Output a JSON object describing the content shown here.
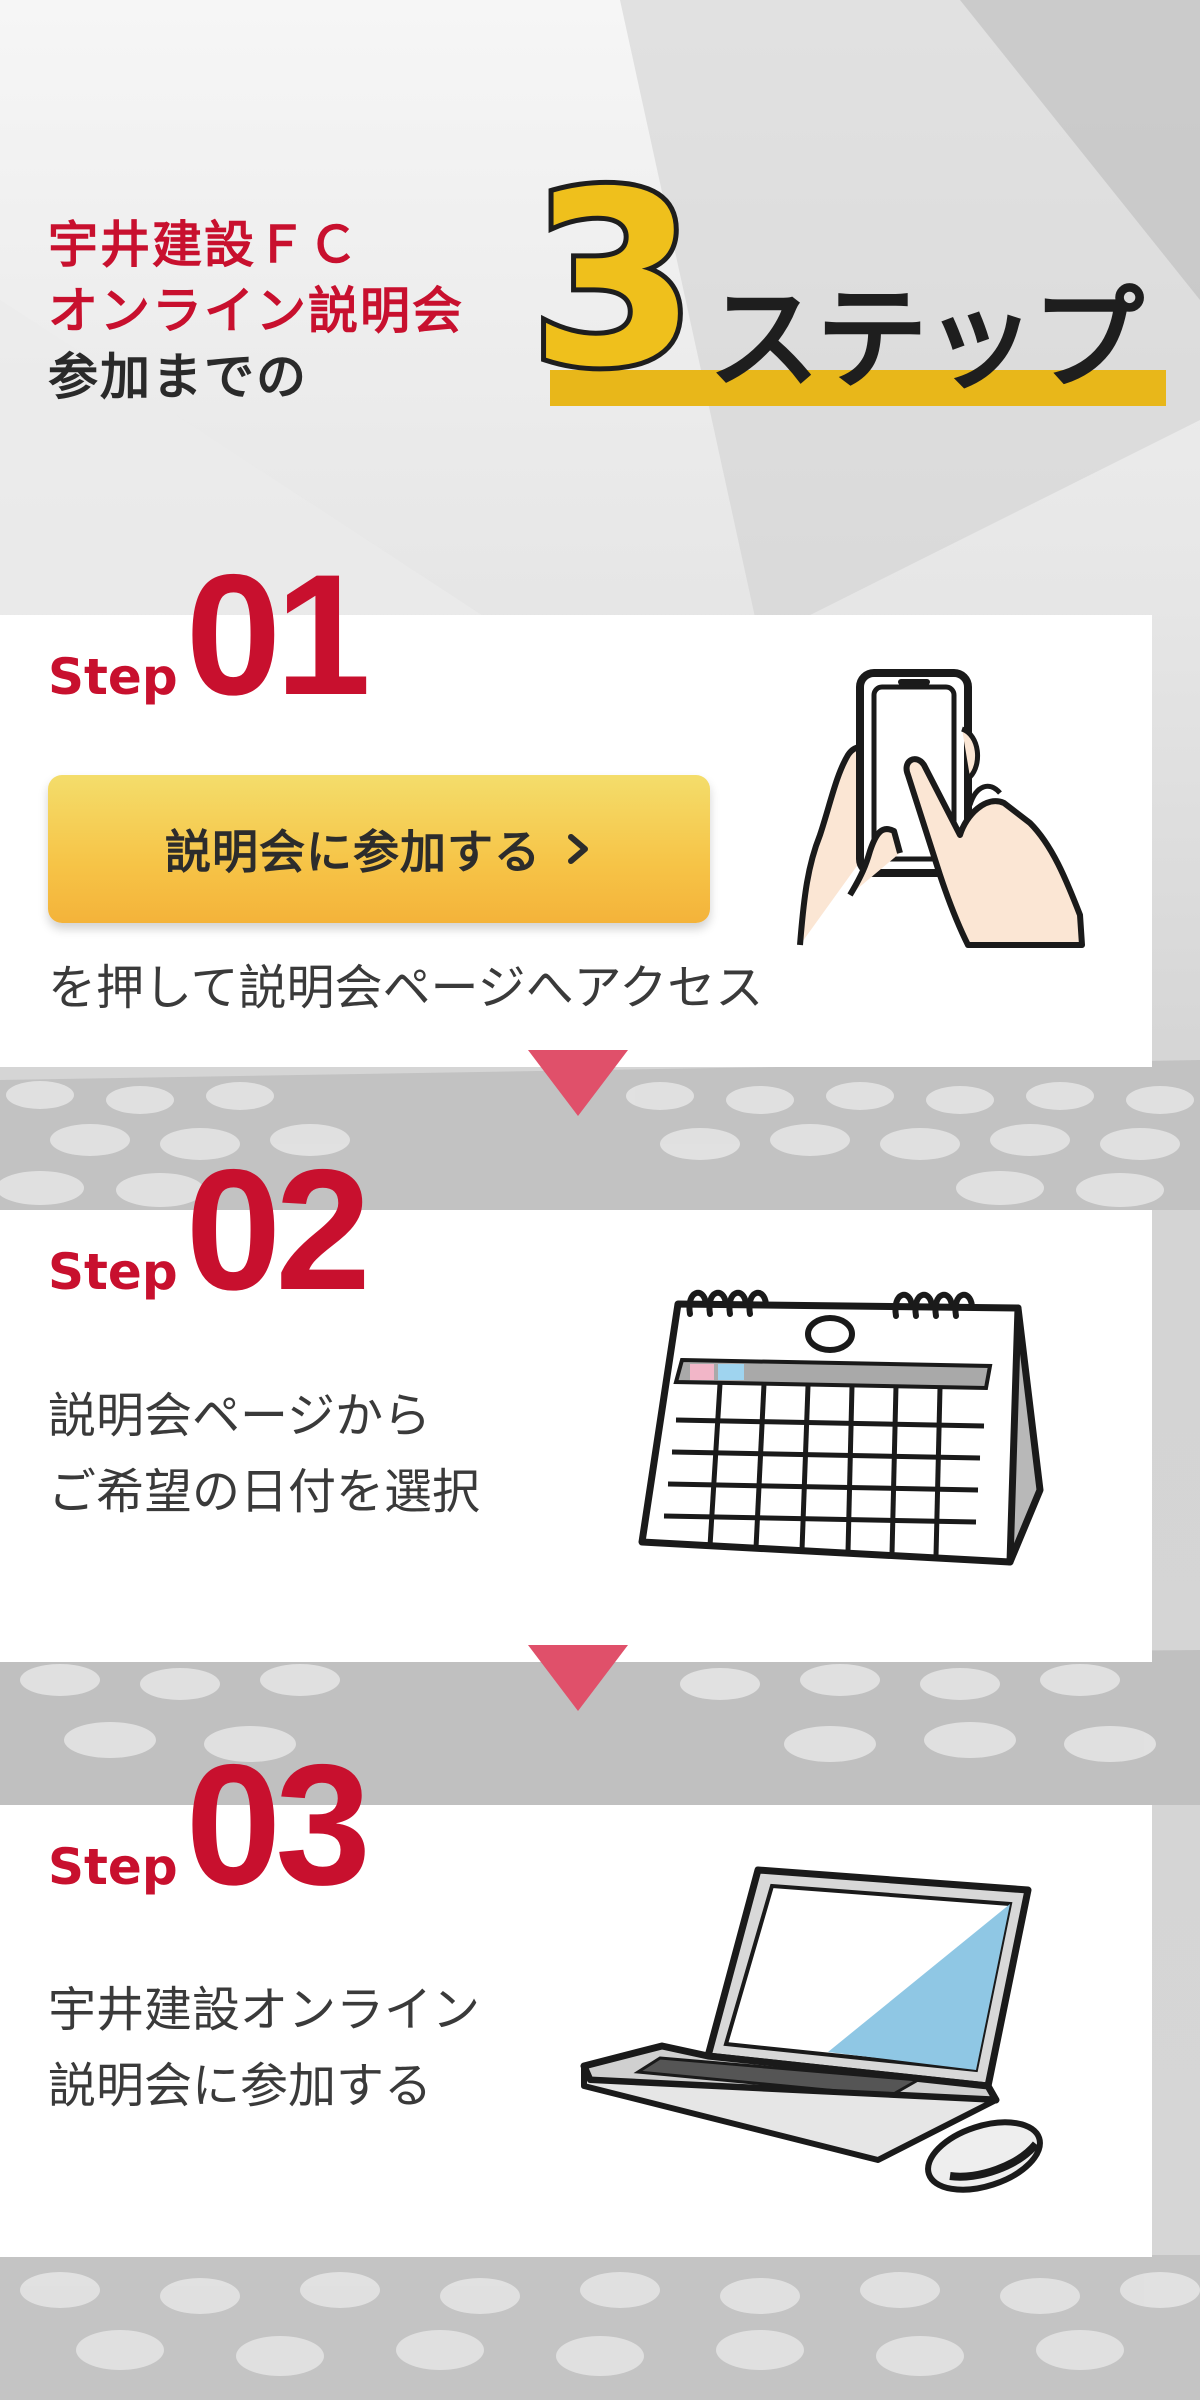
{
  "header": {
    "line1": "宇井建設ＦＣ",
    "line2": "オンライン説明会",
    "line3": "参加までの",
    "big_number": "3",
    "steps_word": "ステップ"
  },
  "steps": [
    {
      "word": "Step",
      "number": "01",
      "button_label": "説明会に参加する",
      "description": "を押して説明会ページへアクセス",
      "icon": "smartphone-hand-icon"
    },
    {
      "word": "Step",
      "number": "02",
      "description_line1": "説明会ページから",
      "description_line2": "ご希望の日付を選択",
      "icon": "calendar-icon"
    },
    {
      "word": "Step",
      "number": "03",
      "description_line1": "宇井建設オンライン",
      "description_line2": "説明会に参加する",
      "icon": "laptop-mouse-icon"
    }
  ],
  "colors": {
    "accent_red": "#c8102e",
    "arrow_pink": "#e0506a",
    "highlight_yellow": "#e8b71a",
    "button_yellow": "#f6c447"
  }
}
